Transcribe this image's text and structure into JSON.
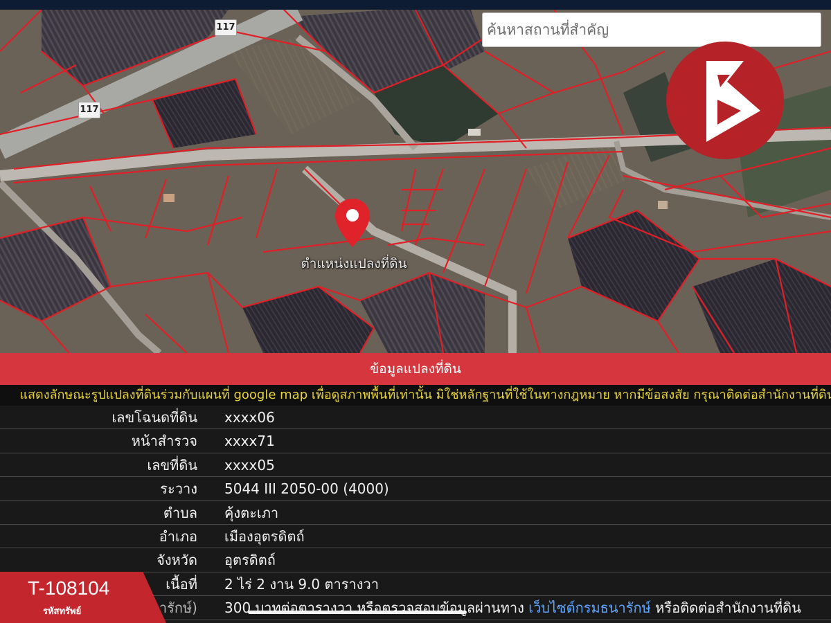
{
  "search": {
    "placeholder": "ค้นหาสถานที่สำคัญ"
  },
  "map": {
    "route_badges": [
      "117",
      "117"
    ],
    "marker_label": "ตำแหน่งแปลงที่ดิน",
    "pin_icon": "map-pin-icon",
    "logo_icon": "brand-logo-icon"
  },
  "panel": {
    "title": "ข้อมูลแปลงที่ดิน",
    "disclaimer": "แสดงลักษณะรูปแปลงที่ดินร่วมกับแผนที่ google map เพื่อดูสภาพพื้นที่เท่านั้น มิใช่หลักฐานที่ใช้ในทางกฎหมาย หากมีข้อสงสัย กรุณาติดต่อสำนักงานที่ดิน",
    "rows": [
      {
        "label": "เลขโฉนดที่ดิน",
        "value": "xxxx06"
      },
      {
        "label": "หน้าสำรวจ",
        "value": "xxxx71"
      },
      {
        "label": "เลขที่ดิน",
        "value": "xxxx05"
      },
      {
        "label": "ระวาง",
        "value": "5044 III 2050-00 (4000)"
      },
      {
        "label": "ตำบล",
        "value": "คุ้งตะเภา"
      },
      {
        "label": "อำเภอ",
        "value": "เมืองอุตรดิตถ์"
      },
      {
        "label": "จังหวัด",
        "value": "อุตรดิตถ์"
      },
      {
        "label": "เนื้อที่",
        "value": "2 ไร่ 2 งาน 9.0 ตารางวา"
      }
    ],
    "last_row": {
      "label": "(กรมธนารักษ์)",
      "value_before": "300 บาทต่อตารางวา หรือตรวจสอบข้อมูลผ่านทาง ",
      "link": "เว็บไซต์กรมธนารักษ์",
      "value_after": " หรือติดต่อสำนักงานที่ดิน"
    }
  },
  "badge": {
    "code": "T-108104",
    "subtitle": "รหัสทรัพย์"
  },
  "colors": {
    "accent": "#d6363d",
    "parcel_line": "#e01f26",
    "disclaimer": "#e6d33c",
    "link": "#5fa6ff"
  }
}
